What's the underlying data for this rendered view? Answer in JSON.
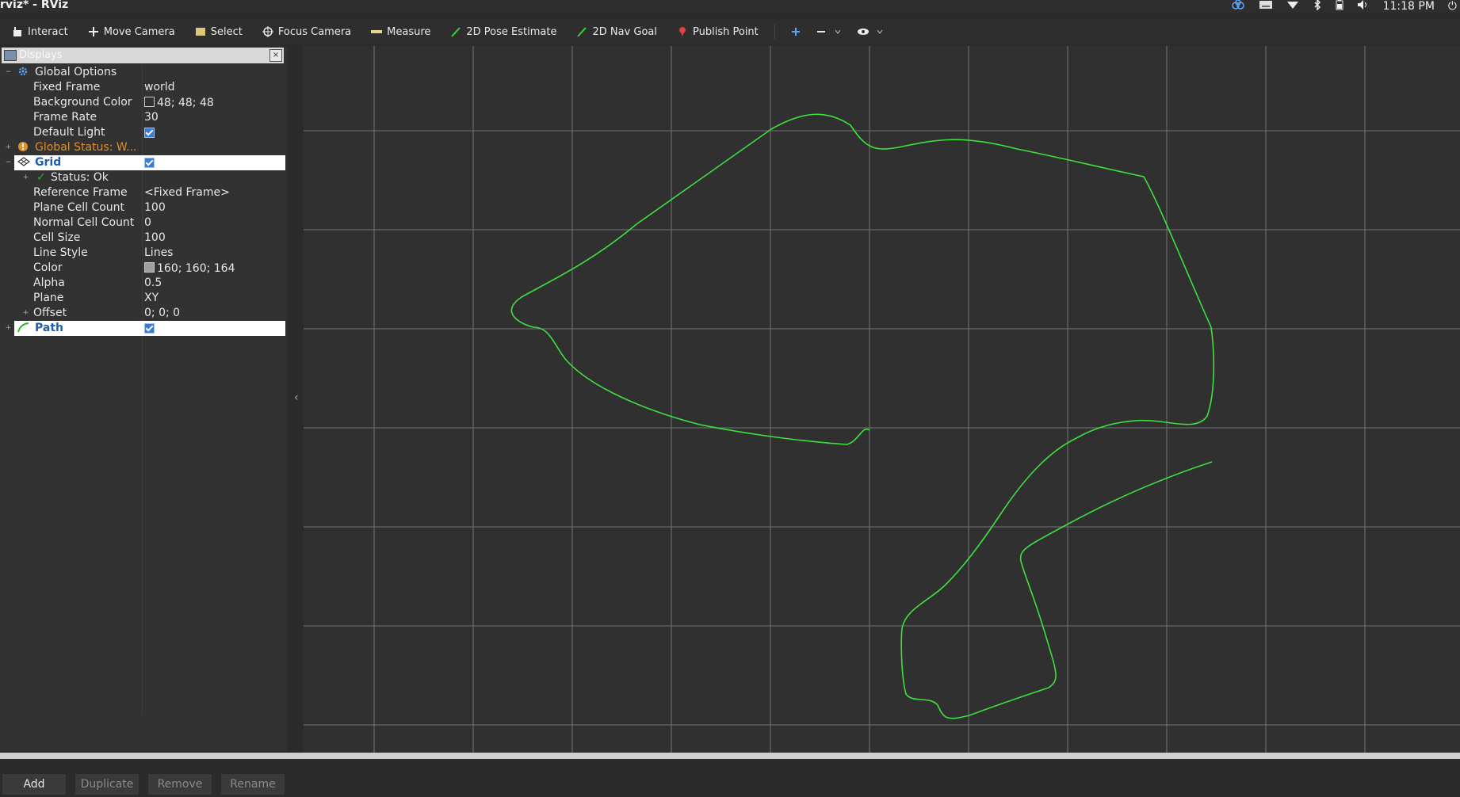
{
  "window": {
    "title": "rviz* - RViz",
    "clock": "11:18 PM"
  },
  "tray_icons": [
    "dropbox-icon",
    "keyboard-icon",
    "wifi-icon",
    "bluetooth-icon",
    "battery-icon",
    "volume-icon"
  ],
  "toolbar": {
    "interact": "Interact",
    "move_camera": "Move Camera",
    "select": "Select",
    "focus_camera": "Focus Camera",
    "measure": "Measure",
    "pose_estimate": "2D Pose Estimate",
    "nav_goal": "2D Nav Goal",
    "publish_point": "Publish Point"
  },
  "displays": {
    "panel_title": "Displays",
    "global_options": {
      "label": "Global Options",
      "fixed_frame": {
        "key": "Fixed Frame",
        "value": "world"
      },
      "background_color": {
        "key": "Background Color",
        "value": "48; 48; 48",
        "swatch": "#303030"
      },
      "frame_rate": {
        "key": "Frame Rate",
        "value": "30"
      },
      "default_light": {
        "key": "Default Light",
        "checked": true
      }
    },
    "global_status": {
      "label": "Global Status: W...",
      "color": "#e0902a"
    },
    "grid": {
      "label": "Grid",
      "checked": true,
      "status": "Status: Ok",
      "reference_frame": {
        "key": "Reference Frame",
        "value": "<Fixed Frame>"
      },
      "plane_cell_count": {
        "key": "Plane Cell Count",
        "value": "100"
      },
      "normal_cell_count": {
        "key": "Normal Cell Count",
        "value": "0"
      },
      "cell_size": {
        "key": "Cell Size",
        "value": "100"
      },
      "line_style": {
        "key": "Line Style",
        "value": "Lines"
      },
      "color": {
        "key": "Color",
        "value": "160; 160; 164",
        "swatch": "#a0a0a4"
      },
      "alpha": {
        "key": "Alpha",
        "value": "0.5"
      },
      "plane": {
        "key": "Plane",
        "value": "XY"
      },
      "offset": {
        "key": "Offset",
        "value": "0; 0; 0"
      }
    },
    "path": {
      "label": "Path",
      "checked": true,
      "color": "#3ee03e"
    }
  },
  "buttons": {
    "add": "Add",
    "duplicate": "Duplicate",
    "remove": "Remove",
    "rename": "Rename"
  }
}
